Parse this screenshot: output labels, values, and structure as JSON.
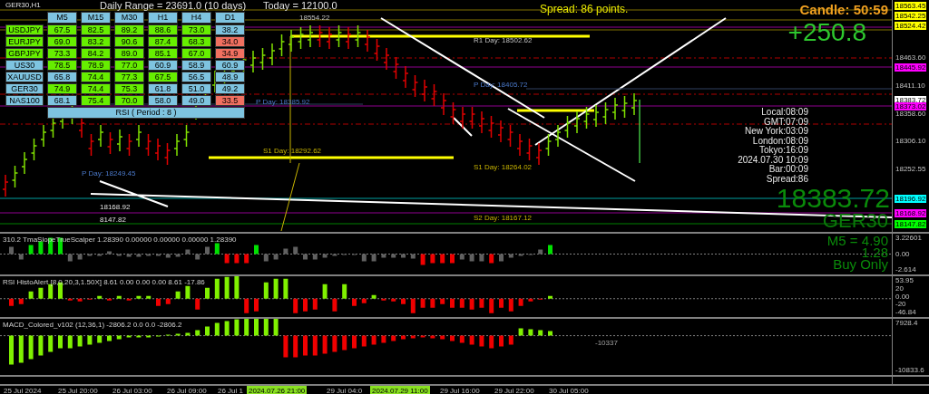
{
  "chart": {
    "symbol": "GER30,H1",
    "daily_range": "Daily Range = 23691.0 (10 days)",
    "today": "Today = 12100.0",
    "spread": "Spread: 86 points.",
    "candle_timer": "Candle:  50:59",
    "profit": "+250.8",
    "big_price": "18383.72",
    "big_symbol": "GER30",
    "levels": [
      {
        "text": "18554.22",
        "kind": "resistance"
      },
      {
        "text": "R1 Day: 18502.62",
        "kind": "resistance"
      },
      {
        "text": "P Day: 18405.72",
        "kind": "pivot"
      },
      {
        "text": "P Day: 18385.92",
        "kind": "pivot"
      },
      {
        "text": "P Day: 18249.45",
        "kind": "pivot"
      },
      {
        "text": "S1 Day: 18292.62",
        "kind": "support"
      },
      {
        "text": "S1 Day: 18264.02",
        "kind": "support"
      },
      {
        "text": "S2 Day: 18167.12",
        "kind": "support"
      },
      {
        "text": "18168.92",
        "kind": "price"
      },
      {
        "text": "8147.82",
        "kind": "price"
      }
    ],
    "clock": [
      "Local:08:09",
      "GMT:07:09",
      "New York:03:09",
      "London:08:09",
      "Tokyo:16:09",
      "2024.07.30 10:09",
      "Bar:00:09",
      "Spread:86"
    ],
    "price_axis": [
      {
        "text": "18563.45",
        "color": "#ffff00"
      },
      {
        "text": "18542.25",
        "color": "#ffff00"
      },
      {
        "text": "18524.42",
        "color": "#ffff00"
      },
      {
        "text": "18463.60"
      },
      {
        "text": "18445.92",
        "color": "#ff00ff"
      },
      {
        "text": "18411.10"
      },
      {
        "text": "18383.72",
        "color": "#ffffff"
      },
      {
        "text": "18373.02",
        "color": "#ff00ff"
      },
      {
        "text": "18358.60"
      },
      {
        "text": "18306.10"
      },
      {
        "text": "18252.55"
      },
      {
        "text": "18196.92",
        "color": "#00ffff"
      },
      {
        "text": "18168.92",
        "color": "#ff00ff"
      },
      {
        "text": "18147.82",
        "color": "#00ff00"
      }
    ]
  },
  "rsi_table": {
    "columns": [
      "M5",
      "M15",
      "M30",
      "H1",
      "H4",
      "D1"
    ],
    "footer": "RSI ( Period : 8 )",
    "rows": [
      {
        "symbol": "USDJPY",
        "color": "#66ee00",
        "cells": [
          {
            "value": "67.5",
            "color": "#66ee00"
          },
          {
            "value": "82.5",
            "color": "#66ee00"
          },
          {
            "value": "89.2",
            "color": "#66ee00"
          },
          {
            "value": "88.6",
            "color": "#66ee00"
          },
          {
            "value": "73.0",
            "color": "#66ee00"
          },
          {
            "value": "38.2",
            "color": "#7ec4e0"
          }
        ]
      },
      {
        "symbol": "EURJPY",
        "color": "#66ee00",
        "cells": [
          {
            "value": "69.0",
            "color": "#66ee00"
          },
          {
            "value": "83.2",
            "color": "#66ee00"
          },
          {
            "value": "90.6",
            "color": "#66ee00"
          },
          {
            "value": "87.4",
            "color": "#66ee00"
          },
          {
            "value": "68.3",
            "color": "#66ee00"
          },
          {
            "value": "34.0",
            "color": "#f07060"
          }
        ]
      },
      {
        "symbol": "GBPJPY",
        "color": "#66ee00",
        "cells": [
          {
            "value": "73.3",
            "color": "#66ee00"
          },
          {
            "value": "84.2",
            "color": "#66ee00"
          },
          {
            "value": "89.0",
            "color": "#66ee00"
          },
          {
            "value": "85.1",
            "color": "#66ee00"
          },
          {
            "value": "67.0",
            "color": "#66ee00"
          },
          {
            "value": "34.9",
            "color": "#f07060"
          }
        ]
      },
      {
        "symbol": "US30",
        "color": "#7ec4e0",
        "cells": [
          {
            "value": "78.5",
            "color": "#66ee00"
          },
          {
            "value": "78.9",
            "color": "#66ee00"
          },
          {
            "value": "77.0",
            "color": "#66ee00"
          },
          {
            "value": "60.9",
            "color": "#7ec4e0"
          },
          {
            "value": "58.9",
            "color": "#7ec4e0"
          },
          {
            "value": "60.9",
            "color": "#7ec4e0"
          }
        ]
      },
      {
        "symbol": "XAUUSD",
        "color": "#7ec4e0",
        "cells": [
          {
            "value": "65.8",
            "color": "#7ec4e0"
          },
          {
            "value": "74.4",
            "color": "#66ee00"
          },
          {
            "value": "77.3",
            "color": "#66ee00"
          },
          {
            "value": "67.5",
            "color": "#66ee00"
          },
          {
            "value": "56.5",
            "color": "#7ec4e0"
          },
          {
            "value": "48.9",
            "color": "#7ec4e0"
          }
        ]
      },
      {
        "symbol": "GER30",
        "color": "#7ec4e0",
        "cells": [
          {
            "value": "74.9",
            "color": "#66ee00"
          },
          {
            "value": "74.4",
            "color": "#66ee00"
          },
          {
            "value": "75.3",
            "color": "#66ee00"
          },
          {
            "value": "61.8",
            "color": "#7ec4e0"
          },
          {
            "value": "51.0",
            "color": "#7ec4e0"
          },
          {
            "value": "49.2",
            "color": "#7ec4e0"
          }
        ]
      },
      {
        "symbol": "NAS100",
        "color": "#7ec4e0",
        "cells": [
          {
            "value": "68.1",
            "color": "#7ec4e0"
          },
          {
            "value": "75.4",
            "color": "#66ee00"
          },
          {
            "value": "70.0",
            "color": "#66ee00"
          },
          {
            "value": "58.0",
            "color": "#7ec4e0"
          },
          {
            "value": "49.0",
            "color": "#7ec4e0"
          },
          {
            "value": "33.5",
            "color": "#f07060"
          }
        ]
      }
    ]
  },
  "indicators": [
    {
      "kind": "tma",
      "title": "310.2 TmaSlopeTrueScalper 1.28390 0.00000 0.00000 0.00000 1.28390",
      "axis": [
        "3.22601",
        "0.00",
        "-2.614"
      ],
      "signals": [
        "M5 = 4.90",
        "1.28",
        "Buy Only"
      ]
    },
    {
      "kind": "rsi",
      "title": "RSI HistoAlert [8,0,20,3,1.50X] 8.61 0.00 0.00 0.00 8.61 -17.86",
      "axis": [
        "53.95",
        "20",
        "0.00",
        "-20",
        "-46.84"
      ]
    },
    {
      "kind": "macd",
      "title": "MACD_Colored_v102 (12,36,1) -2806.2 0.0 0.0 -2806.2",
      "axis": [
        "7928.4",
        "-10833.6"
      ],
      "value_label": "-10337"
    }
  ],
  "time_axis": [
    {
      "text": "25 Jul 2024",
      "highlighted": false
    },
    {
      "text": "25 Jul 20:00",
      "highlighted": false
    },
    {
      "text": "26 Jul 03:00",
      "highlighted": false
    },
    {
      "text": "26 Jul 09:00",
      "highlighted": false
    },
    {
      "text": "26 Jul 1",
      "highlighted": false
    },
    {
      "text": "2024.07.26 21:00",
      "highlighted": true
    },
    {
      "text": "29 Jul 04:0",
      "highlighted": false
    },
    {
      "text": "2024.07.29 11:00",
      "highlighted": true
    },
    {
      "text": "29 Jul 16:00",
      "highlighted": false
    },
    {
      "text": "29 Jul 22:00",
      "highlighted": false
    },
    {
      "text": "30 Jul 05:00",
      "highlighted": false
    }
  ]
}
